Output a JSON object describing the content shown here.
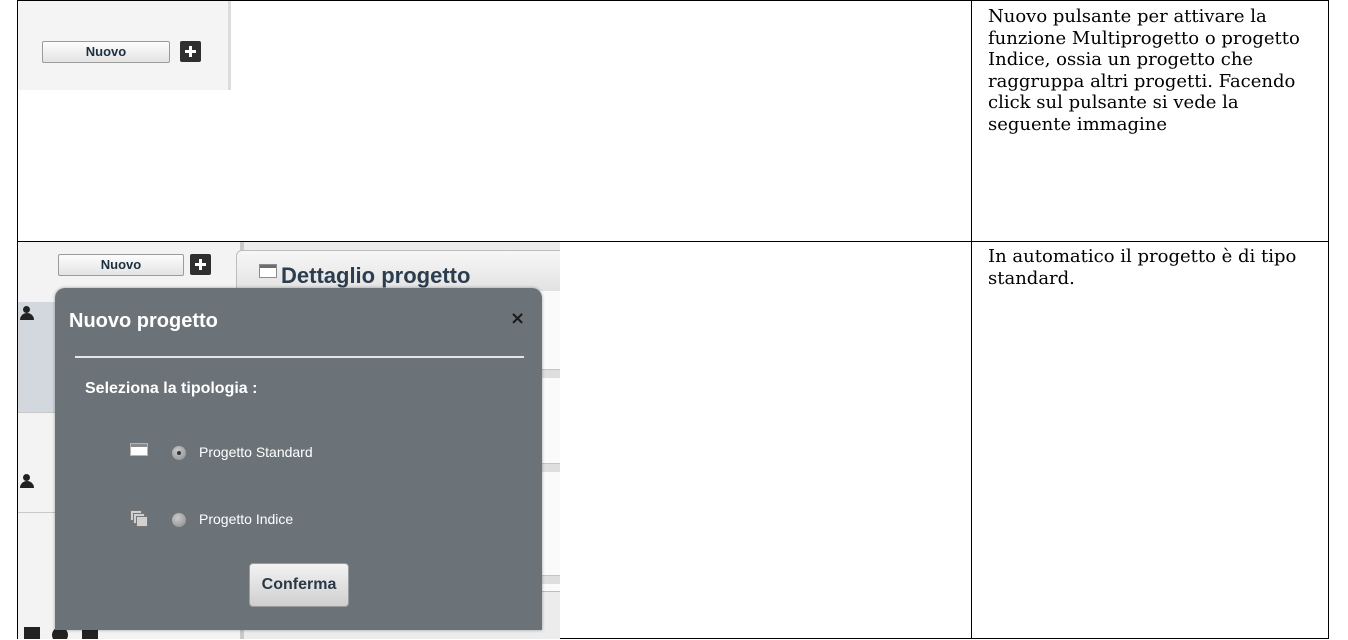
{
  "row1": {
    "screenshot": {
      "new_button_label": "Nuovo"
    },
    "description": "Nuovo pulsante per attivare la funzione Multiprogetto o progetto Indice, ossia un progetto che raggruppa altri progetti. Facendo click sul pulsante si vede la seguente immagine"
  },
  "row2": {
    "screenshot": {
      "new_button_label": "Nuovo",
      "detail_panel_title": "Dettaglio progetto",
      "dialog": {
        "title": "Nuovo progetto",
        "close_symbol": "×",
        "select_label": "Seleziona la tipologia :",
        "options": [
          {
            "label": "Progetto Standard",
            "icon": "window-icon",
            "selected": true
          },
          {
            "label": "Progetto Indice",
            "icon": "stacked-pages-icon",
            "selected": false
          }
        ],
        "confirm_label": "Conferma"
      }
    },
    "description": "In automatico il progetto è di tipo standard."
  }
}
